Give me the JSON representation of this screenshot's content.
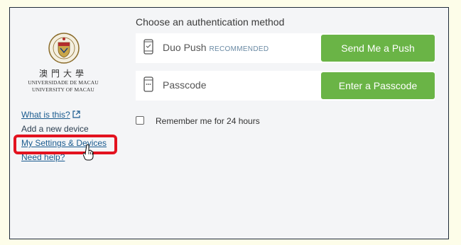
{
  "university": {
    "chinese_name": "澳門大學",
    "portuguese_name": "UNIVERSIDADE DE MACAU",
    "english_name": "UNIVERSITY OF MACAU"
  },
  "sidebar": {
    "links": [
      {
        "label": "What is this?"
      },
      {
        "label": "Add a new device"
      },
      {
        "label": "My Settings & Devices"
      },
      {
        "label": "Need help?"
      }
    ]
  },
  "main": {
    "heading": "Choose an authentication method",
    "methods": [
      {
        "label": "Duo Push",
        "badge": "RECOMMENDED",
        "button": "Send Me a Push",
        "icon": "phone-icon"
      },
      {
        "label": "Passcode",
        "badge": "",
        "button": "Enter a Passcode",
        "icon": "passcode-device-icon"
      }
    ],
    "remember": {
      "label": "Remember me for 24 hours",
      "checked": false
    }
  },
  "colors": {
    "button_green": "#6ab446",
    "highlight_red": "#e3121f",
    "link_blue": "#1a5b8f"
  }
}
